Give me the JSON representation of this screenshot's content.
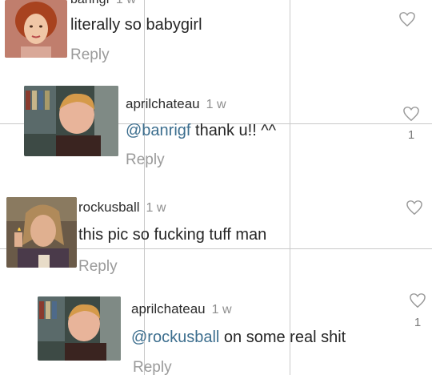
{
  "comments": [
    {
      "username": "banrigf",
      "time": "1 w",
      "text": "literally so babygirl",
      "reply_label": "Reply",
      "likes": "",
      "avatar": "red-haired-girl-avatar"
    },
    {
      "username": "aprilchateau",
      "time": "1 w",
      "mention": "@banrigf",
      "text": " thank u!! ^^",
      "reply_label": "Reply",
      "likes": "1",
      "avatar": "blond-boy-library-avatar"
    },
    {
      "username": "rockusball",
      "time": "1 w",
      "text": "this pic so fucking tuff man",
      "reply_label": "Reply",
      "likes": "",
      "avatar": "long-haired-guy-lighter-avatar"
    },
    {
      "username": "aprilchateau",
      "time": "1 w",
      "mention": "@rockusball",
      "text": " on some real shit",
      "reply_label": "Reply",
      "likes": "1",
      "avatar": "blond-boy-library-avatar"
    }
  ],
  "colors": {
    "mention": "#3c6e8e",
    "reply": "#9a9a9a",
    "gridline": "#c9c9c9",
    "heart": "#9a9a9a"
  },
  "icons": [
    "heart-outline-icon"
  ]
}
